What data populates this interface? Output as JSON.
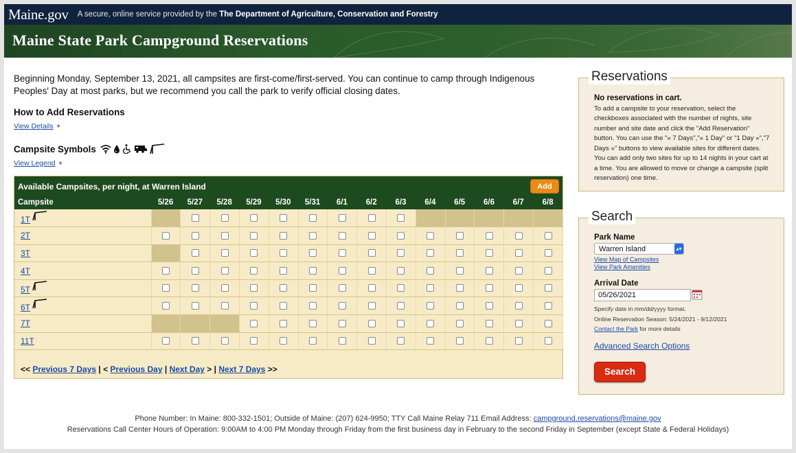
{
  "header": {
    "logo": "Maine.gov",
    "tagline_prefix": "A secure, online service provided by the",
    "tagline_dept": "The Department of Agriculture, Conservation and Forestry",
    "banner_title": "Maine State Park Campground Reservations"
  },
  "intro": "Beginning Monday, September 13, 2021, all campsites are first-come/first-served. You can continue to camp through Indigenous Peoples' Day at most parks, but we recommend you call the park to verify official closing dates.",
  "how_to": {
    "heading": "How to Add Reservations",
    "link": "View Details",
    "plus": "+"
  },
  "symbols": {
    "heading": "Campsite Symbols",
    "link": "View Legend",
    "plus": "+",
    "icons": [
      "wifi-icon",
      "water-icon",
      "accessible-icon",
      "rv-icon",
      "lean-to-icon"
    ]
  },
  "availability": {
    "title": "Available Campsites, per night, at Warren Island",
    "add_label": "Add",
    "campsite_header": "Campsite",
    "dates": [
      "5/26",
      "5/27",
      "5/28",
      "5/29",
      "5/30",
      "5/31",
      "6/1",
      "6/2",
      "6/3",
      "6/4",
      "6/5",
      "6/6",
      "6/7",
      "6/8"
    ],
    "rows": [
      {
        "site": "1T",
        "leanto": true,
        "avail": [
          0,
          1,
          1,
          1,
          1,
          1,
          1,
          1,
          1,
          0,
          0,
          0,
          0,
          0
        ]
      },
      {
        "site": "2T",
        "leanto": false,
        "avail": [
          1,
          1,
          1,
          1,
          1,
          1,
          1,
          1,
          1,
          1,
          1,
          1,
          1,
          1
        ]
      },
      {
        "site": "3T",
        "leanto": false,
        "avail": [
          0,
          1,
          1,
          1,
          1,
          1,
          1,
          1,
          1,
          1,
          1,
          1,
          1,
          1
        ]
      },
      {
        "site": "4T",
        "leanto": false,
        "avail": [
          1,
          1,
          1,
          1,
          1,
          1,
          1,
          1,
          1,
          1,
          1,
          1,
          1,
          1
        ]
      },
      {
        "site": "5T",
        "leanto": true,
        "avail": [
          1,
          1,
          1,
          1,
          1,
          1,
          1,
          1,
          1,
          1,
          1,
          1,
          1,
          1
        ]
      },
      {
        "site": "6T",
        "leanto": true,
        "avail": [
          1,
          1,
          1,
          1,
          1,
          1,
          1,
          1,
          1,
          1,
          1,
          1,
          1,
          1
        ]
      },
      {
        "site": "7T",
        "leanto": false,
        "avail": [
          0,
          0,
          0,
          1,
          1,
          1,
          1,
          1,
          1,
          1,
          1,
          1,
          1,
          1
        ]
      },
      {
        "site": "11T",
        "leanto": false,
        "avail": [
          1,
          1,
          1,
          1,
          1,
          1,
          1,
          1,
          1,
          1,
          1,
          1,
          1,
          1
        ]
      }
    ],
    "pager": {
      "prev7_prefix": "<<",
      "prev7": "Previous 7 Days",
      "sep1": "|",
      "prev_day_prefix": "<",
      "prev_day": "Previous Day",
      "sep2": "|",
      "next_day": "Next Day",
      "next_day_suffix": ">",
      "sep3": "|",
      "next7": "Next 7 Days",
      "next7_suffix": ">>"
    }
  },
  "reservations": {
    "title": "Reservations",
    "empty": "No reservations in cart.",
    "help": "To add a campsite to your reservation, select the checkboxes associated with the number of nights, site number and site date and click the \"Add Reservation\" button. You can use the \"« 7 Days\",\"« 1 Day\" or \"1 Day »\",\"7 Days »\" buttons to view available sites for different dates. You can add only two sites for up to 14 nights in your cart at a time. You are allowed to move or change a campsite (split reservation) one time."
  },
  "search": {
    "title": "Search",
    "park_label": "Park Name",
    "park_value": "Warren Island",
    "map_link": "View Map of Campsites",
    "amenities_link": "View Park Amenities",
    "arrival_label": "Arrival Date",
    "arrival_value": "05/26/2021",
    "format_note": "Specify date in mm/dd/yyyy format.",
    "season_note": "Online Reservation Season: 5/24/2021 - 9/12/2021",
    "contact_link": "Contact the Park",
    "contact_suffix": "for more details",
    "advanced_link": "Advanced Search Options",
    "button": "Search"
  },
  "footer": {
    "phone_line": "Phone Number: In Maine: 800-332-1501; Outside of Maine: (207) 624-9950; TTY Call Maine Relay 711 Email Address:",
    "email": "campground.reservations@maine.gov",
    "hours_line": "Reservations Call Center Hours of Operation: 9:00AM to 4:00 PM Monday through Friday from the first business day in February to the second Friday in September (except State & Federal Holidays)"
  },
  "colors": {
    "header_bg": "#10233e",
    "banner_bg": "#2a5a2b",
    "table_head": "#1e4a1f",
    "row_bg": "#f6ebc6",
    "unavailable": "#d2c28e",
    "add_button": "#ec8a16",
    "search_button": "#d92b12",
    "link": "#1a4aa8"
  }
}
